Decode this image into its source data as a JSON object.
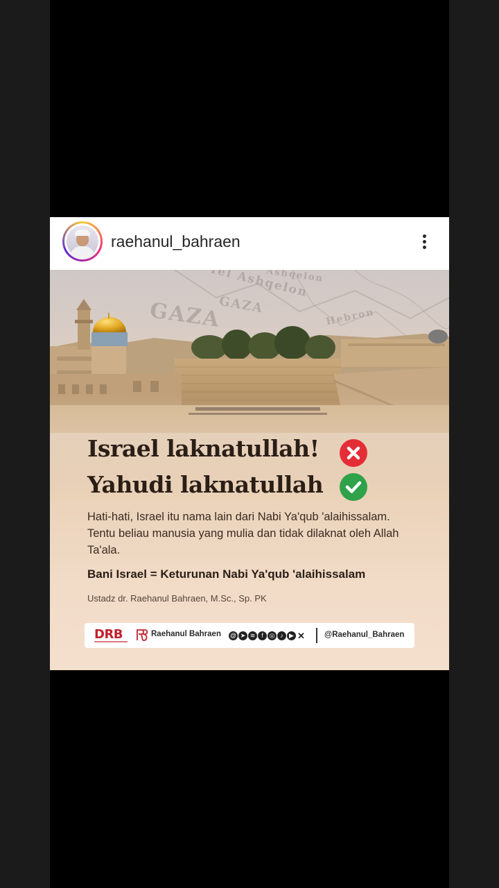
{
  "post": {
    "username": "raehanul_bahraen"
  },
  "image": {
    "map_labels": [
      "Tel Ashqelon",
      "GAZA",
      "GAZA",
      "Hebron",
      "Ashqelon"
    ],
    "headline_1": "Israel laknatullah!",
    "headline_2": "Yahudi laknatullah",
    "body": "Hati-hati, Israel itu nama lain dari Nabi Ya'qub 'alaihissalam. Tentu beliau manusia yang mulia dan tidak dilaknat oleh Allah Ta'ala.",
    "bold_line": "Bani Israel = Keturunan Nabi Ya'qub 'alaihissalam",
    "author": "Ustadz dr. Raehanul Bahraen, M.Sc., Sp. PK",
    "footer": {
      "logo_text": "DRB",
      "brand_name": "Raehanul Bahraen",
      "handle": "@Raehanul_Bahraen",
      "social_icons": [
        "threads-icon",
        "telegram-icon",
        "spotify-icon",
        "facebook-icon",
        "instagram-icon",
        "tiktok-icon",
        "youtube-icon",
        "x-icon"
      ]
    }
  },
  "colors": {
    "cross_mark": "#e52d36",
    "check_mark": "#2fa24a",
    "logo_red": "#c0202b"
  }
}
